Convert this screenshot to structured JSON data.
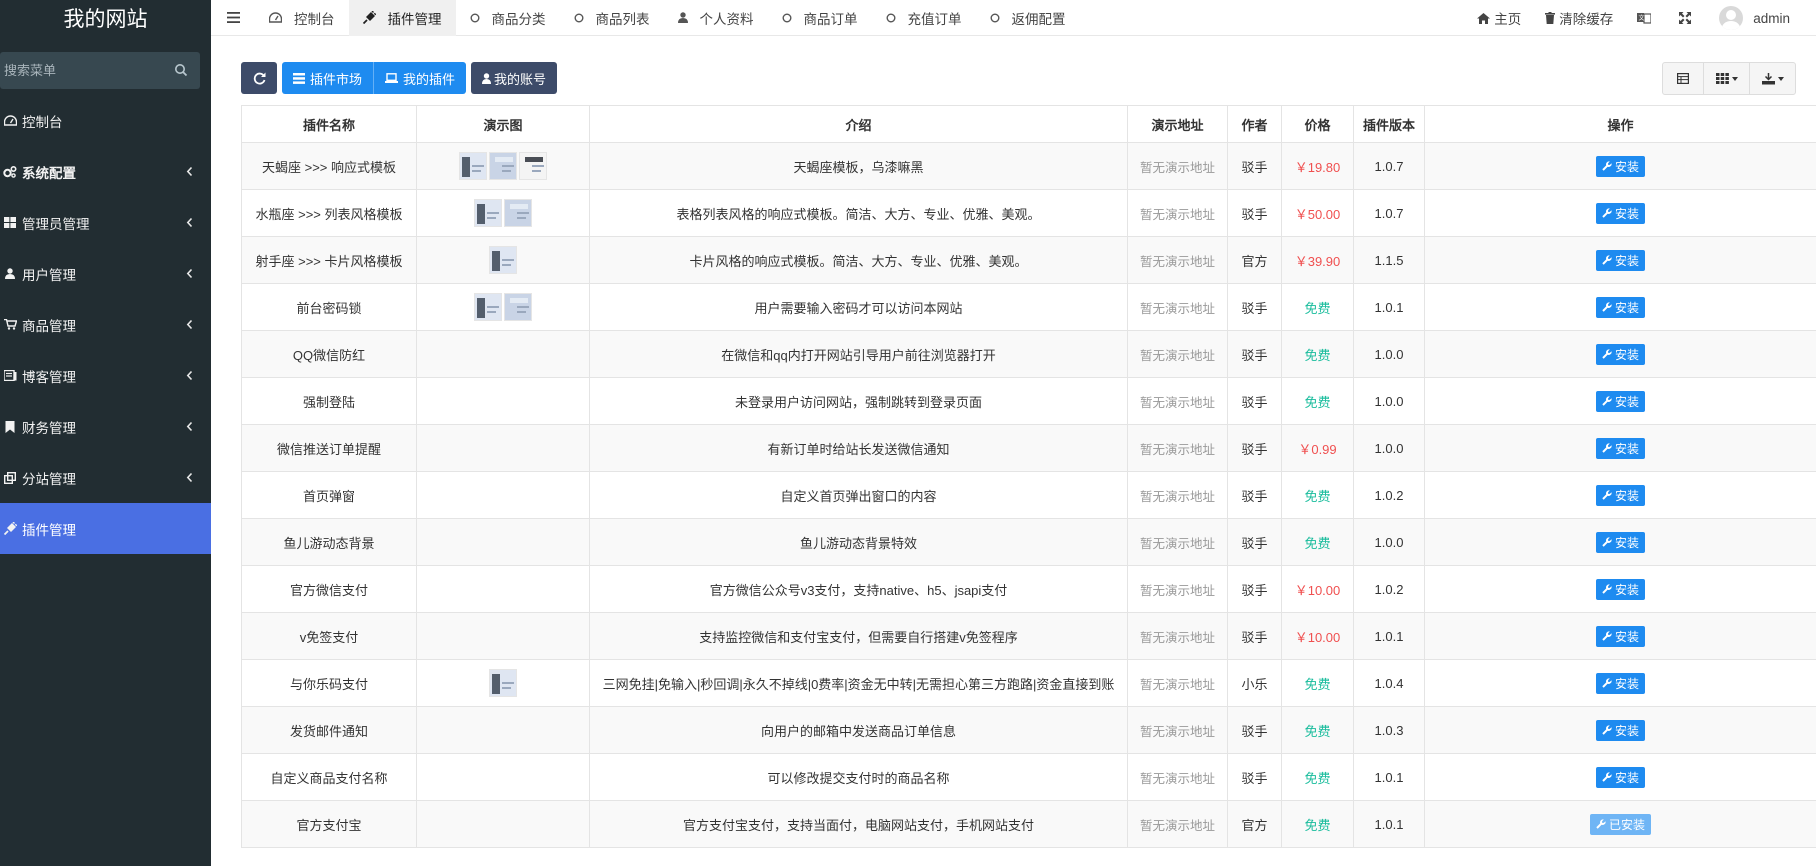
{
  "sidebar": {
    "logo": "我的网站",
    "search_placeholder": "搜索菜单",
    "items": [
      {
        "label": "控制台",
        "icon": "dashboard-icon",
        "has_children": false,
        "active": false
      },
      {
        "label": "系统配置",
        "icon": "cogs-icon",
        "has_children": true,
        "active": false,
        "bold": true
      },
      {
        "label": "管理员管理",
        "icon": "windows-icon",
        "has_children": true,
        "active": false
      },
      {
        "label": "用户管理",
        "icon": "user-icon",
        "has_children": true,
        "active": false
      },
      {
        "label": "商品管理",
        "icon": "cart-icon",
        "has_children": true,
        "active": false
      },
      {
        "label": "博客管理",
        "icon": "blog-icon",
        "has_children": true,
        "active": false
      },
      {
        "label": "财务管理",
        "icon": "bookmark-icon",
        "has_children": true,
        "active": false
      },
      {
        "label": "分站管理",
        "icon": "clone-icon",
        "has_children": true,
        "active": false
      },
      {
        "label": "插件管理",
        "icon": "plug-icon",
        "has_children": false,
        "active": true
      }
    ]
  },
  "topbar": {
    "tabs": [
      {
        "label": "控制台",
        "icon": "dashboard-icon",
        "active": false
      },
      {
        "label": "插件管理",
        "icon": "plug-icon",
        "active": true
      },
      {
        "label": "商品分类",
        "icon": "circle-icon",
        "active": false
      },
      {
        "label": "商品列表",
        "icon": "circle-icon",
        "active": false
      },
      {
        "label": "个人资料",
        "icon": "user-icon",
        "active": false
      },
      {
        "label": "商品订单",
        "icon": "circle-icon",
        "active": false
      },
      {
        "label": "充值订单",
        "icon": "circle-icon",
        "active": false
      },
      {
        "label": "返佣配置",
        "icon": "circle-icon",
        "active": false
      }
    ],
    "home_label": "主页",
    "clear_cache_label": "清除缓存",
    "username": "admin"
  },
  "toolbar": {
    "market_label": "插件市场",
    "my_plugins_label": "我的插件",
    "account_label": "我的账号"
  },
  "table": {
    "headers": [
      "插件名称",
      "演示图",
      "介绍",
      "演示地址",
      "作者",
      "价格",
      "插件版本",
      "操作"
    ],
    "rows": [
      {
        "name": "天蝎座 >>> 响应式模板",
        "thumbs": 3,
        "desc": "天蝎座模板，乌漆嘛黑",
        "demo": "暂无演示地址",
        "author": "驳手",
        "price": "￥19.80",
        "paid": true,
        "version": "1.0.7",
        "action": "安装",
        "installed": false
      },
      {
        "name": "水瓶座 >>> 列表风格模板",
        "thumbs": 2,
        "desc": "表格列表风格的响应式模板。简洁、大方、专业、优雅、美观。",
        "demo": "暂无演示地址",
        "author": "驳手",
        "price": "￥50.00",
        "paid": true,
        "version": "1.0.7",
        "action": "安装",
        "installed": false
      },
      {
        "name": "射手座 >>> 卡片风格模板",
        "thumbs": 1,
        "desc": "卡片风格的响应式模板。简洁、大方、专业、优雅、美观。",
        "demo": "暂无演示地址",
        "author": "官方",
        "price": "￥39.90",
        "paid": true,
        "version": "1.1.5",
        "action": "安装",
        "installed": false
      },
      {
        "name": "前台密码锁",
        "thumbs": 2,
        "desc": "用户需要输入密码才可以访问本网站",
        "demo": "暂无演示地址",
        "author": "驳手",
        "price": "免费",
        "paid": false,
        "version": "1.0.1",
        "action": "安装",
        "installed": false
      },
      {
        "name": "QQ微信防红",
        "thumbs": 0,
        "desc": "在微信和qq内打开网站引导用户前往浏览器打开",
        "demo": "暂无演示地址",
        "author": "驳手",
        "price": "免费",
        "paid": false,
        "version": "1.0.0",
        "action": "安装",
        "installed": false
      },
      {
        "name": "强制登陆",
        "thumbs": 0,
        "desc": "未登录用户访问网站，强制跳转到登录页面",
        "demo": "暂无演示地址",
        "author": "驳手",
        "price": "免费",
        "paid": false,
        "version": "1.0.0",
        "action": "安装",
        "installed": false
      },
      {
        "name": "微信推送订单提醒",
        "thumbs": 0,
        "desc": "有新订单时给站长发送微信通知",
        "demo": "暂无演示地址",
        "author": "驳手",
        "price": "￥0.99",
        "paid": true,
        "version": "1.0.0",
        "action": "安装",
        "installed": false
      },
      {
        "name": "首页弹窗",
        "thumbs": 0,
        "desc": "自定义首页弹出窗口的内容",
        "demo": "暂无演示地址",
        "author": "驳手",
        "price": "免费",
        "paid": false,
        "version": "1.0.2",
        "action": "安装",
        "installed": false
      },
      {
        "name": "鱼儿游动态背景",
        "thumbs": 0,
        "desc": "鱼儿游动态背景特效",
        "demo": "暂无演示地址",
        "author": "驳手",
        "price": "免费",
        "paid": false,
        "version": "1.0.0",
        "action": "安装",
        "installed": false
      },
      {
        "name": "官方微信支付",
        "thumbs": 0,
        "desc": "官方微信公众号v3支付，支持native、h5、jsapi支付",
        "demo": "暂无演示地址",
        "author": "驳手",
        "price": "￥10.00",
        "paid": true,
        "version": "1.0.2",
        "action": "安装",
        "installed": false
      },
      {
        "name": "v免签支付",
        "thumbs": 0,
        "desc": "支持监控微信和支付宝支付，但需要自行搭建v免签程序",
        "demo": "暂无演示地址",
        "author": "驳手",
        "price": "￥10.00",
        "paid": true,
        "version": "1.0.1",
        "action": "安装",
        "installed": false
      },
      {
        "name": "与你乐码支付",
        "thumbs": 1,
        "desc": "三网免挂|免输入|秒回调|永久不掉线|0费率|资金无中转|无需担心第三方跑路|资金直接到账",
        "demo": "暂无演示地址",
        "author": "小乐",
        "price": "免费",
        "paid": false,
        "version": "1.0.4",
        "action": "安装",
        "installed": false
      },
      {
        "name": "发货邮件通知",
        "thumbs": 0,
        "desc": "向用户的邮箱中发送商品订单信息",
        "demo": "暂无演示地址",
        "author": "驳手",
        "price": "免费",
        "paid": false,
        "version": "1.0.3",
        "action": "安装",
        "installed": false
      },
      {
        "name": "自定义商品支付名称",
        "thumbs": 0,
        "desc": "可以修改提交支付时的商品名称",
        "demo": "暂无演示地址",
        "author": "驳手",
        "price": "免费",
        "paid": false,
        "version": "1.0.1",
        "action": "安装",
        "installed": false
      },
      {
        "name": "官方支付宝",
        "thumbs": 0,
        "desc": "官方支付宝支付，支持当面付，电脑网站支付，手机网站支付",
        "demo": "暂无演示地址",
        "author": "官方",
        "price": "免费",
        "paid": false,
        "version": "1.0.1",
        "action": "已安装",
        "installed": true
      }
    ]
  },
  "colors": {
    "sidebar_bg": "#222d32",
    "active_menu": "#4a6fe3",
    "primary": "#1e8bf0",
    "dark_button": "#3d4b69",
    "price_paid": "#f05050",
    "price_free": "#18bc9c"
  }
}
